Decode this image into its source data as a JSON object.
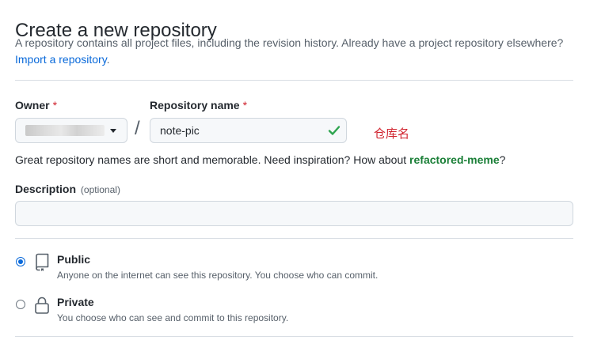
{
  "header": {
    "title": "Create a new repository",
    "subtitle": "A repository contains all project files, including the revision history. Already have a project repository elsewhere?",
    "import_link": "Import a repository",
    "import_suffix": "."
  },
  "owner": {
    "label": "Owner",
    "required_mark": "*"
  },
  "separator": "/",
  "repository_name": {
    "label": "Repository name",
    "required_mark": "*",
    "value": "note-pic",
    "valid": true,
    "annotation": "仓库名"
  },
  "name_hint": {
    "text": "Great repository names are short and memorable. Need inspiration? How about ",
    "suggestion": "refactored-meme",
    "suffix": "?"
  },
  "description": {
    "label": "Description",
    "optional_label": "(optional)",
    "value": ""
  },
  "visibility": {
    "options": [
      {
        "label": "Public",
        "description": "Anyone on the internet can see this repository. You choose who can commit.",
        "icon": "repo-icon",
        "selected": true
      },
      {
        "label": "Private",
        "description": "You choose who can see and commit to this repository.",
        "icon": "lock-icon",
        "selected": false
      }
    ]
  },
  "colors": {
    "link": "#0969da",
    "required": "#cf222e",
    "success": "#1a7f37",
    "annotation": "#d1242f"
  }
}
